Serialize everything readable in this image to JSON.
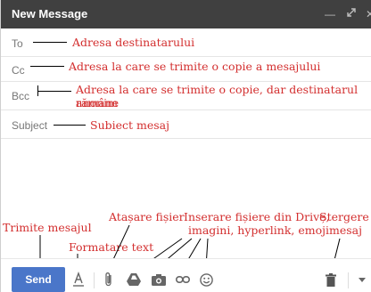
{
  "window": {
    "title": "New Message",
    "controls": [
      "minimize-icon",
      "popout-icon",
      "close-icon"
    ]
  },
  "fields": {
    "to": {
      "label": "To",
      "annotation": "Adresa destinatarului"
    },
    "cc": {
      "label": "Cc",
      "annotation": "Adresa la care se trimite o copie a mesajului"
    },
    "bcc": {
      "label": "Bcc",
      "annotation_line1": "Adresa la care se trimite o copie, dar destinatarul rămâne",
      "annotation_line2": "anonim"
    },
    "subject": {
      "label": "Subject",
      "annotation": "Subiect mesaj"
    }
  },
  "annotations": {
    "send": "Trimite mesajul",
    "format": "Formatare text",
    "attach": "Atașare fișier",
    "insert_line1": "Inserare fișiere din Drive,",
    "insert_line2": "imagini, hyperlink, emoji",
    "delete_line1": "Ștergere",
    "delete_line2": "mesaj"
  },
  "toolbar": {
    "send_label": "Send",
    "icons": [
      "format-text-icon",
      "attach-icon",
      "drive-icon",
      "photo-icon",
      "link-icon",
      "emoji-icon",
      "trash-icon",
      "more-options-icon"
    ]
  },
  "colors": {
    "annotation": "#d32f2f",
    "titlebar": "#404040",
    "send_button": "#4a76c9"
  }
}
